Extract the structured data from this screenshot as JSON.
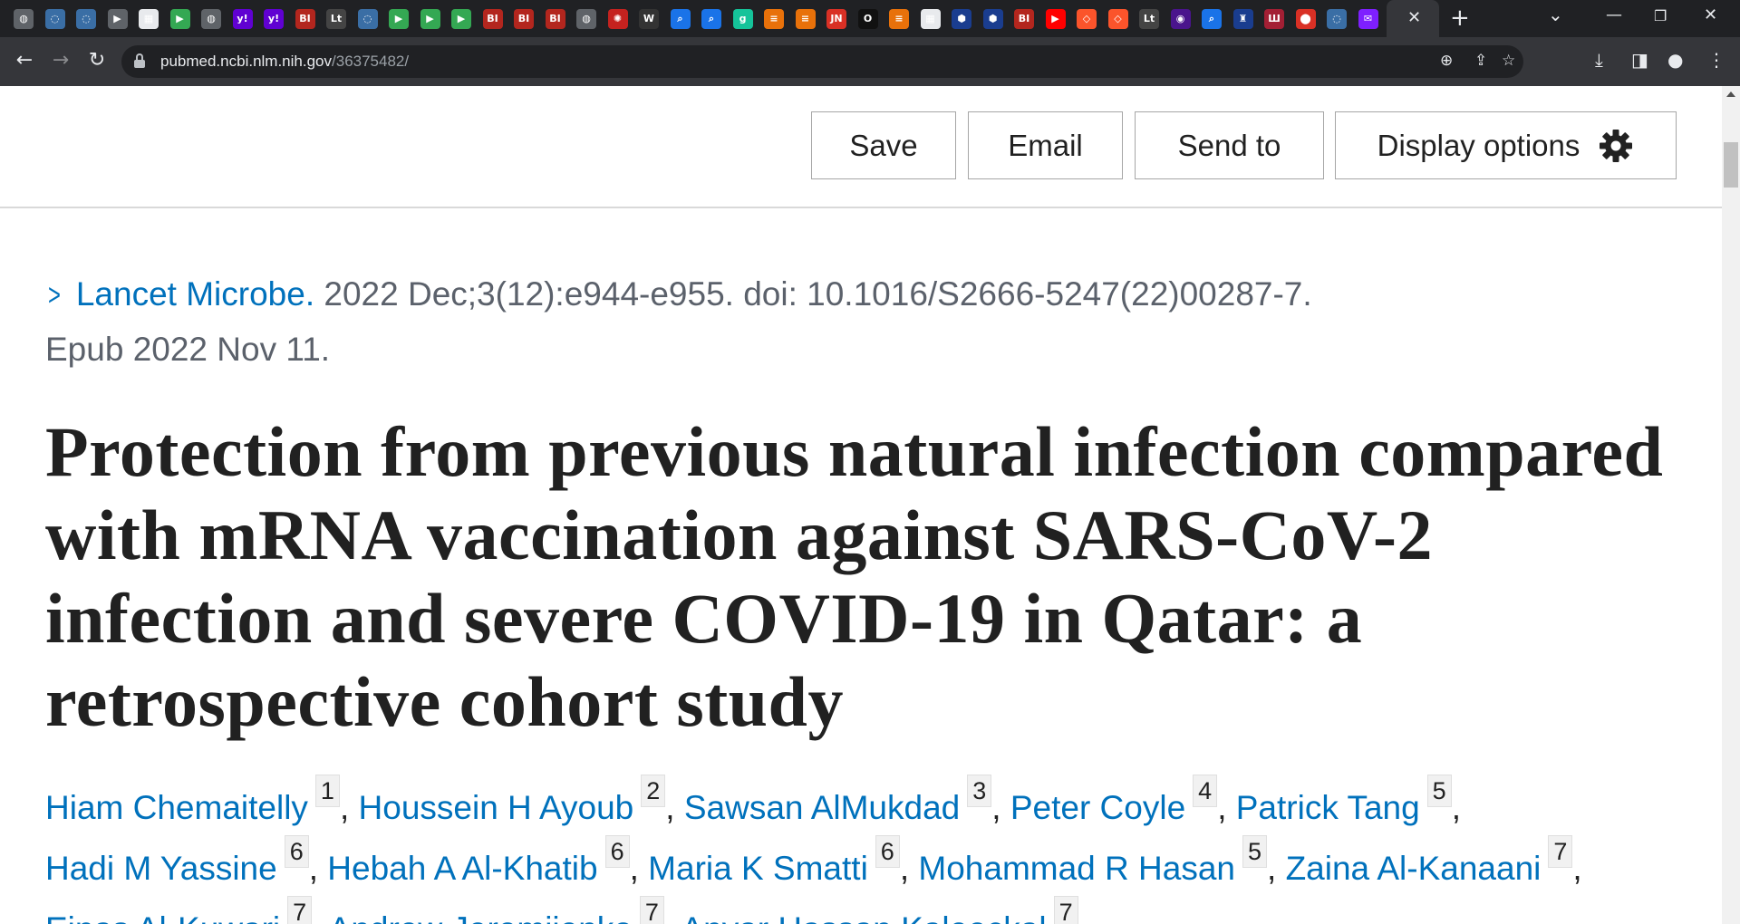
{
  "browser": {
    "tabs": [
      {
        "icon": "globe-icon",
        "color": "#5f6368",
        "glyph": "◍"
      },
      {
        "icon": "shield-icon",
        "color": "#3a6ea5",
        "glyph": "◌"
      },
      {
        "icon": "shield-icon",
        "color": "#3a6ea5",
        "glyph": "◌"
      },
      {
        "icon": "video-icon",
        "color": "#5f6368",
        "glyph": "▶"
      },
      {
        "icon": "puzzle-icon",
        "color": "#e8eaed",
        "glyph": "▦"
      },
      {
        "icon": "play-icon",
        "color": "#34a853",
        "glyph": "▶"
      },
      {
        "icon": "globe-icon",
        "color": "#5f6368",
        "glyph": "◍"
      },
      {
        "icon": "yahoo-icon",
        "color": "#6001d2",
        "glyph": "y!"
      },
      {
        "icon": "yahoo-icon",
        "color": "#6001d2",
        "glyph": "y!"
      },
      {
        "icon": "business-insider-icon",
        "color": "#b3261e",
        "glyph": "BI"
      },
      {
        "icon": "script-icon",
        "color": "#444",
        "glyph": "Lt"
      },
      {
        "icon": "shield-icon",
        "color": "#3a6ea5",
        "glyph": "◌"
      },
      {
        "icon": "play-icon",
        "color": "#34a853",
        "glyph": "▶"
      },
      {
        "icon": "play-icon",
        "color": "#34a853",
        "glyph": "▶"
      },
      {
        "icon": "play-icon",
        "color": "#34a853",
        "glyph": "▶"
      },
      {
        "icon": "business-insider-icon",
        "color": "#b3261e",
        "glyph": "BI"
      },
      {
        "icon": "business-insider-icon",
        "color": "#b3261e",
        "glyph": "BI"
      },
      {
        "icon": "business-insider-icon",
        "color": "#b3261e",
        "glyph": "BI"
      },
      {
        "icon": "globe-icon",
        "color": "#5f6368",
        "glyph": "◍"
      },
      {
        "icon": "burst-icon",
        "color": "#c5221f",
        "glyph": "✺"
      },
      {
        "icon": "newspaper-icon",
        "color": "#333",
        "glyph": "W"
      },
      {
        "icon": "search-icon",
        "color": "#1a73e8",
        "glyph": "⌕"
      },
      {
        "icon": "search-icon",
        "color": "#1a73e8",
        "glyph": "⌕"
      },
      {
        "icon": "grammarly-icon",
        "color": "#15c39a",
        "glyph": "g"
      },
      {
        "icon": "bookmark-icon",
        "color": "#e8710a",
        "glyph": "≡"
      },
      {
        "icon": "bookmark-icon",
        "color": "#e8710a",
        "glyph": "≡"
      },
      {
        "icon": "jn-icon",
        "color": "#d93025",
        "glyph": "JN"
      },
      {
        "icon": "circle-icon",
        "color": "#111",
        "glyph": "O"
      },
      {
        "icon": "bookmark-icon",
        "color": "#e8710a",
        "glyph": "≡"
      },
      {
        "icon": "grid-icon",
        "color": "#e8eaed",
        "glyph": "▦"
      },
      {
        "icon": "hex-icon",
        "color": "#1a3d8f",
        "glyph": "⬢"
      },
      {
        "icon": "hex-icon",
        "color": "#1a3d8f",
        "glyph": "⬢"
      },
      {
        "icon": "business-insider-icon",
        "color": "#b3261e",
        "glyph": "BI"
      },
      {
        "icon": "youtube-icon",
        "color": "#ff0000",
        "glyph": "▶"
      },
      {
        "icon": "brave-icon",
        "color": "#fb542b",
        "glyph": "◇"
      },
      {
        "icon": "brave-icon",
        "color": "#fb542b",
        "glyph": "◇"
      },
      {
        "icon": "script-icon",
        "color": "#444",
        "glyph": "Lt"
      },
      {
        "icon": "badge-icon",
        "color": "#4a148c",
        "glyph": "◉"
      },
      {
        "icon": "search-icon",
        "color": "#1a73e8",
        "glyph": "⌕"
      },
      {
        "icon": "crest-icon",
        "color": "#1a3d8f",
        "glyph": "♜"
      },
      {
        "icon": "library-icon",
        "color": "#a31f34",
        "glyph": "Ш"
      },
      {
        "icon": "pin-icon",
        "color": "#d93025",
        "glyph": "⬤"
      },
      {
        "icon": "shield-icon",
        "color": "#3a6ea5",
        "glyph": "◌"
      },
      {
        "icon": "mail-icon",
        "color": "#7e1fff",
        "glyph": "✉"
      }
    ],
    "url_host": "pubmed.ncbi.nlm.nih.gov",
    "url_path": "/36375482/"
  },
  "actions": {
    "save": "Save",
    "email": "Email",
    "send_to": "Send to",
    "display_options": "Display options"
  },
  "citation": {
    "journal": "Lancet Microbe.",
    "details": " 2022 Dec;3(12):e944-e955. doi: 10.1016/S2666-5247(22)00287-7.",
    "epub": "Epub 2022 Nov 11."
  },
  "title": "Protection from previous natural infection compared with mRNA vaccination against SARS-CoV-2 infection and severe COVID-19 in Qatar: a retrospective cohort study",
  "authors": [
    {
      "name": "Hiam Chemaitelly",
      "aff": "1"
    },
    {
      "name": "Houssein H Ayoub",
      "aff": "2"
    },
    {
      "name": "Sawsan AlMukdad",
      "aff": "3"
    },
    {
      "name": "Peter Coyle",
      "aff": "4"
    },
    {
      "name": "Patrick Tang",
      "aff": "5"
    },
    {
      "name": "Hadi M Yassine",
      "aff": "6"
    },
    {
      "name": "Hebah A Al-Khatib",
      "aff": "6"
    },
    {
      "name": "Maria K Smatti",
      "aff": "6"
    },
    {
      "name": "Mohammad R Hasan",
      "aff": "5"
    },
    {
      "name": "Zaina Al-Kanaani",
      "aff": "7"
    },
    {
      "name": "Einas Al-Kuwari",
      "aff": "7"
    },
    {
      "name": "Andrew Jeremijenko",
      "aff": "7"
    },
    {
      "name": "Anvar Hassan Kaleeckal",
      "aff": "7"
    }
  ]
}
